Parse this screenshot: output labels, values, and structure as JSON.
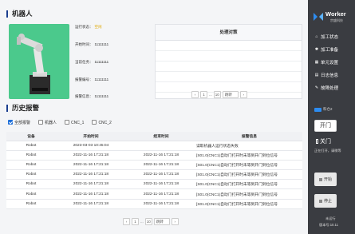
{
  "robot": {
    "title": "机器人",
    "fields": [
      {
        "label": "运行状态：",
        "value": "空闲"
      },
      {
        "label": "开始时间：",
        "value": "11111111"
      },
      {
        "label": "当前任务：",
        "value": "11111111"
      },
      {
        "label": "报警编号：",
        "value": "11111111"
      },
      {
        "label": "报警信息：",
        "value": "11111111"
      }
    ]
  },
  "measures": {
    "header": "处理对策"
  },
  "pager_top": {
    "prev": "‹",
    "page": "1",
    "sep": "...",
    "last": "10",
    "jump": "跳转",
    "next": "›"
  },
  "history": {
    "title": "历史报警",
    "filters": [
      "全部报警",
      "机器人",
      "CNC_1",
      "CNC_2"
    ],
    "columns": [
      "设备",
      "开始时间",
      "结束时间",
      "报警信息"
    ],
    "rows": [
      [
        "Robot",
        "2023-03-03 10:45:04",
        "",
        "读取机器人运行状态失败"
      ],
      [
        "Robot",
        "2022-11-16   17:21:18",
        "2022-11-16   17:21:18",
        "[S01.0(CNC1)自动门打开时未等到开门到位信号"
      ],
      [
        "Robot",
        "2022-11-16   17:21:18",
        "2022-11-16   17:21:18",
        "[S01.0(CNC1)自动门打开时未等到开门到位信号"
      ],
      [
        "Robot",
        "2022-11-16   17:21:18",
        "2022-11-16   17:21:18",
        "[S01.0(CNC1)自动门打开时未等到开门到位信号"
      ],
      [
        "Robot",
        "2022-11-16   17:21:18",
        "2022-11-16   17:21:18",
        "[S01.0(CNC1)自动门打开时未等到开门到位信号"
      ],
      [
        "Robot",
        "2022-11-16   17:21:18",
        "2022-11-16   17:21:18",
        "[S01.0(CNC1)自动门打开时未等到开门到位信号"
      ],
      [
        "Robot",
        "2022-11-16   17:21:18",
        "2022-11-16   17:21:18",
        "[S01.0(CNC1)自动门打开时未等到开门到位信号"
      ]
    ]
  },
  "pager_bottom": {
    "prev": "‹",
    "page": "1",
    "sep": "...",
    "last": "10",
    "jump": "跳转",
    "next": "›"
  },
  "sidebar": {
    "brand": "Worker",
    "brand_sub": "宗盛科技",
    "menu": [
      "加工状态",
      "加工准备",
      "单元设置",
      "日志信息",
      "故障处理"
    ],
    "station_label": "料仓2",
    "open_label": "开门",
    "close_label": "关门",
    "door_hint": "正在打开，请稍等",
    "start_label": "开始",
    "stop_label": "停止",
    "status_text": "未运行",
    "version": "版本号:10.11"
  },
  "colors": {
    "robot_bg": "#4bc98c",
    "accent": "#1a3d8f",
    "status_idle": "#e0a800",
    "sidebar_bg": "#3a3c41"
  }
}
